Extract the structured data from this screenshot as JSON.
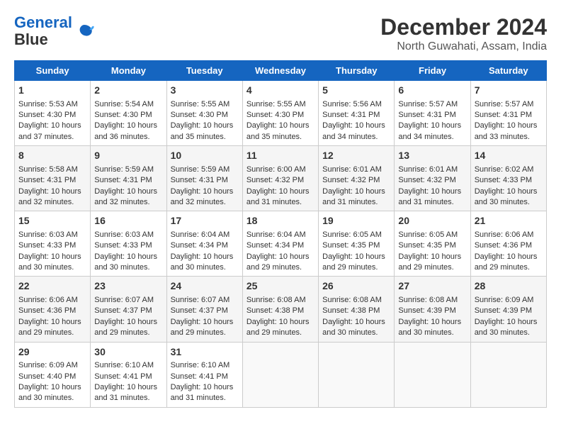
{
  "logo": {
    "line1": "General",
    "line2": "Blue"
  },
  "title": "December 2024",
  "subtitle": "North Guwahati, Assam, India",
  "days_of_week": [
    "Sunday",
    "Monday",
    "Tuesday",
    "Wednesday",
    "Thursday",
    "Friday",
    "Saturday"
  ],
  "weeks": [
    [
      {
        "day": "1",
        "sunrise": "5:53 AM",
        "sunset": "4:30 PM",
        "daylight": "10 hours and 37 minutes."
      },
      {
        "day": "2",
        "sunrise": "5:54 AM",
        "sunset": "4:30 PM",
        "daylight": "10 hours and 36 minutes."
      },
      {
        "day": "3",
        "sunrise": "5:55 AM",
        "sunset": "4:30 PM",
        "daylight": "10 hours and 35 minutes."
      },
      {
        "day": "4",
        "sunrise": "5:55 AM",
        "sunset": "4:30 PM",
        "daylight": "10 hours and 35 minutes."
      },
      {
        "day": "5",
        "sunrise": "5:56 AM",
        "sunset": "4:31 PM",
        "daylight": "10 hours and 34 minutes."
      },
      {
        "day": "6",
        "sunrise": "5:57 AM",
        "sunset": "4:31 PM",
        "daylight": "10 hours and 34 minutes."
      },
      {
        "day": "7",
        "sunrise": "5:57 AM",
        "sunset": "4:31 PM",
        "daylight": "10 hours and 33 minutes."
      }
    ],
    [
      {
        "day": "8",
        "sunrise": "5:58 AM",
        "sunset": "4:31 PM",
        "daylight": "10 hours and 32 minutes."
      },
      {
        "day": "9",
        "sunrise": "5:59 AM",
        "sunset": "4:31 PM",
        "daylight": "10 hours and 32 minutes."
      },
      {
        "day": "10",
        "sunrise": "5:59 AM",
        "sunset": "4:31 PM",
        "daylight": "10 hours and 32 minutes."
      },
      {
        "day": "11",
        "sunrise": "6:00 AM",
        "sunset": "4:32 PM",
        "daylight": "10 hours and 31 minutes."
      },
      {
        "day": "12",
        "sunrise": "6:01 AM",
        "sunset": "4:32 PM",
        "daylight": "10 hours and 31 minutes."
      },
      {
        "day": "13",
        "sunrise": "6:01 AM",
        "sunset": "4:32 PM",
        "daylight": "10 hours and 31 minutes."
      },
      {
        "day": "14",
        "sunrise": "6:02 AM",
        "sunset": "4:33 PM",
        "daylight": "10 hours and 30 minutes."
      }
    ],
    [
      {
        "day": "15",
        "sunrise": "6:03 AM",
        "sunset": "4:33 PM",
        "daylight": "10 hours and 30 minutes."
      },
      {
        "day": "16",
        "sunrise": "6:03 AM",
        "sunset": "4:33 PM",
        "daylight": "10 hours and 30 minutes."
      },
      {
        "day": "17",
        "sunrise": "6:04 AM",
        "sunset": "4:34 PM",
        "daylight": "10 hours and 30 minutes."
      },
      {
        "day": "18",
        "sunrise": "6:04 AM",
        "sunset": "4:34 PM",
        "daylight": "10 hours and 29 minutes."
      },
      {
        "day": "19",
        "sunrise": "6:05 AM",
        "sunset": "4:35 PM",
        "daylight": "10 hours and 29 minutes."
      },
      {
        "day": "20",
        "sunrise": "6:05 AM",
        "sunset": "4:35 PM",
        "daylight": "10 hours and 29 minutes."
      },
      {
        "day": "21",
        "sunrise": "6:06 AM",
        "sunset": "4:36 PM",
        "daylight": "10 hours and 29 minutes."
      }
    ],
    [
      {
        "day": "22",
        "sunrise": "6:06 AM",
        "sunset": "4:36 PM",
        "daylight": "10 hours and 29 minutes."
      },
      {
        "day": "23",
        "sunrise": "6:07 AM",
        "sunset": "4:37 PM",
        "daylight": "10 hours and 29 minutes."
      },
      {
        "day": "24",
        "sunrise": "6:07 AM",
        "sunset": "4:37 PM",
        "daylight": "10 hours and 29 minutes."
      },
      {
        "day": "25",
        "sunrise": "6:08 AM",
        "sunset": "4:38 PM",
        "daylight": "10 hours and 29 minutes."
      },
      {
        "day": "26",
        "sunrise": "6:08 AM",
        "sunset": "4:38 PM",
        "daylight": "10 hours and 30 minutes."
      },
      {
        "day": "27",
        "sunrise": "6:08 AM",
        "sunset": "4:39 PM",
        "daylight": "10 hours and 30 minutes."
      },
      {
        "day": "28",
        "sunrise": "6:09 AM",
        "sunset": "4:39 PM",
        "daylight": "10 hours and 30 minutes."
      }
    ],
    [
      {
        "day": "29",
        "sunrise": "6:09 AM",
        "sunset": "4:40 PM",
        "daylight": "10 hours and 30 minutes."
      },
      {
        "day": "30",
        "sunrise": "6:10 AM",
        "sunset": "4:41 PM",
        "daylight": "10 hours and 31 minutes."
      },
      {
        "day": "31",
        "sunrise": "6:10 AM",
        "sunset": "4:41 PM",
        "daylight": "10 hours and 31 minutes."
      },
      null,
      null,
      null,
      null
    ]
  ]
}
